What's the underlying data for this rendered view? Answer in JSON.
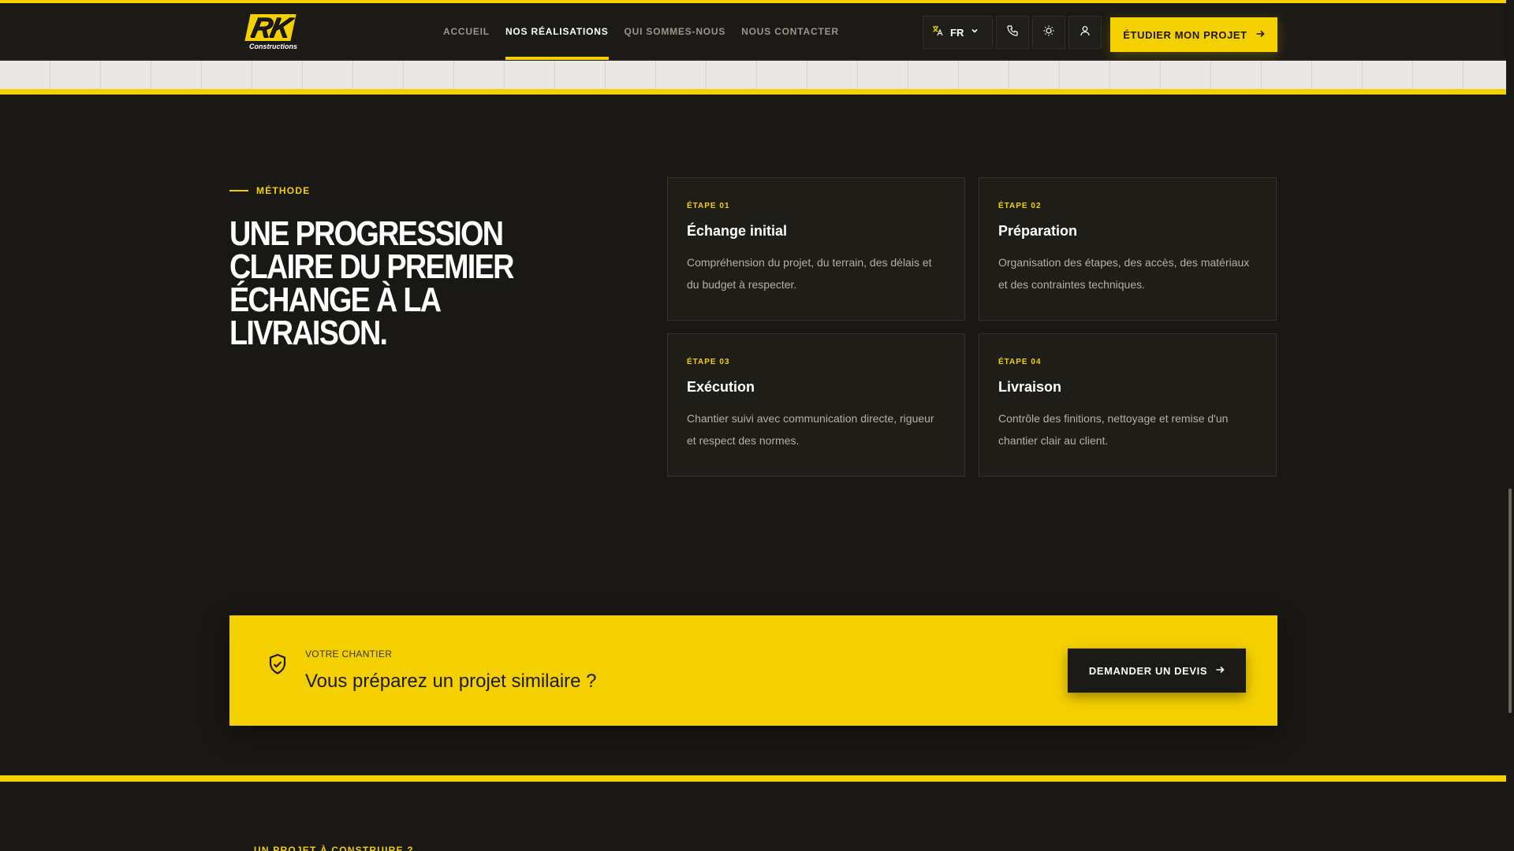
{
  "colors": {
    "accent": "#f5d000",
    "background": "#1a1814",
    "card": "#1f1d18"
  },
  "header": {
    "logo": {
      "mark": "RK",
      "subtitle": "Constructions"
    },
    "nav": [
      {
        "label": "ACCUEIL"
      },
      {
        "label": "NOS RÉALISATIONS"
      },
      {
        "label": "QUI SOMMES-NOUS"
      },
      {
        "label": "NOUS CONTACTER"
      }
    ],
    "active_nav": "NOS RÉALISATIONS",
    "language": {
      "code": "FR",
      "icon": "translate-icon"
    },
    "icons": [
      "phone-icon",
      "sun-icon",
      "user-icon"
    ],
    "cta_label": "ÉTUDIER MON PROJET"
  },
  "method": {
    "eyebrow": "MÉTHODE",
    "headline": [
      "UNE PROGRESSION",
      "CLAIRE DU PREMIER",
      "ÉCHANGE À LA LIVRAISON."
    ],
    "steps": [
      {
        "step": "ÉTAPE 01",
        "title": "Échange initial",
        "text": "Compréhension du projet, du terrain, des délais et du budget à respecter."
      },
      {
        "step": "ÉTAPE 02",
        "title": "Préparation",
        "text": "Organisation des étapes, des accès, des matériaux et des contraintes techniques."
      },
      {
        "step": "ÉTAPE 03",
        "title": "Exécution",
        "text": "Chantier suivi avec communication directe, rigueur et respect des normes."
      },
      {
        "step": "ÉTAPE 04",
        "title": "Livraison",
        "text": "Contrôle des finitions, nettoyage et remise d'un chantier clair au client."
      }
    ]
  },
  "banner": {
    "kicker": "VOTRE CHANTIER",
    "title": "Vous préparez un projet similaire ?",
    "button_label": "DEMANDER UN DEVIS",
    "icon": "shield-check-icon"
  },
  "next_section": {
    "eyebrow": "UN PROJET À CONSTRUIRE ?"
  }
}
